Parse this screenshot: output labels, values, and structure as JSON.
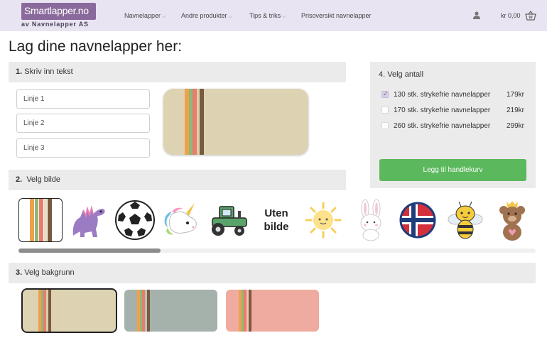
{
  "header": {
    "logo_text": "Smartlapper.no",
    "logo_sub": "av Navnelapper AS",
    "nav": [
      "Navnelapper",
      "Andre produkter",
      "Tips & triks",
      "Prisoversikt navnelapper"
    ],
    "cart_text": "kr 0,00"
  },
  "page_title": "Lag dine navnelapper her:",
  "step1": {
    "number": "1.",
    "label": "Skriv inn tekst",
    "inputs": [
      "Linje 1",
      "Linje 2",
      "Linje 3"
    ]
  },
  "step2": {
    "number": "2.",
    "label": "Velg bilde",
    "images": [
      "stripes",
      "dinosaur",
      "football",
      "unicorn",
      "tractor",
      "no-image",
      "sun",
      "bunny",
      "norway-flag",
      "bee",
      "teddy-bear"
    ],
    "no_image_line1": "Uten",
    "no_image_line2": "bilde"
  },
  "step3": {
    "number": "3.",
    "label": "Velg bakgrunn",
    "backgrounds": [
      "#ddd3b2",
      "#a5b2ab",
      "#f0aba0"
    ]
  },
  "step4": {
    "number": "4.",
    "label": "Velg antall",
    "options": [
      {
        "name": "130 stk. strykefrie navnelapper",
        "price": "179kr",
        "checked": true
      },
      {
        "name": "170 stk. strykefrie navnelapper",
        "price": "219kr",
        "checked": false
      },
      {
        "name": "260 stk. strykefrie navnelapper",
        "price": "299kr",
        "checked": false
      }
    ],
    "button_label": "Legg til handlekurv"
  },
  "colors": {
    "header_bg": "#e9e4f1",
    "brand": "#8a6a9c",
    "button": "#5cb85c",
    "stripe_orange": "#f0a04b",
    "stripe_green": "#8db87a",
    "stripe_salmon": "#ea7c6b",
    "stripe_brown": "#7a5a3f"
  }
}
